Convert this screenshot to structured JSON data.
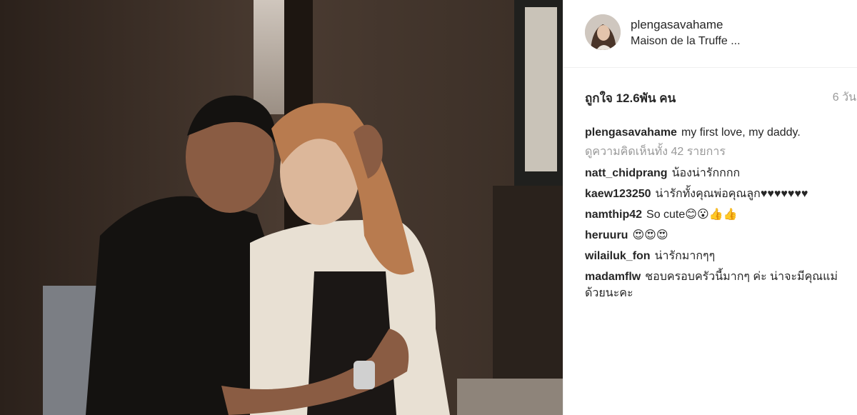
{
  "header": {
    "username": "plengasavahame",
    "location": "Maison de la Truffe ..."
  },
  "stats": {
    "likes": "ถูกใจ 12.6พัน คน",
    "time": "6 วัน"
  },
  "caption": {
    "username": "plengasavahame",
    "text": "my first love, my daddy."
  },
  "view_all": "ดูความคิดเห็นทั้ง 42 รายการ",
  "comments": [
    {
      "username": "natt_chidprang",
      "text": "น้องน่ารักกกก"
    },
    {
      "username": "kaew123250",
      "text": "น่ารักทั้งคุณพ่อคุณลูก♥♥♥♥♥♥♥"
    },
    {
      "username": "namthip42",
      "text": "So cute😊😮👍👍"
    },
    {
      "username": "heruuru",
      "text": "😍😍😍"
    },
    {
      "username": "wilailuk_fon",
      "text": "น่ารักมากๆๆ"
    },
    {
      "username": "madamflw",
      "text": "ชอบครอบครัวนี้มากๆ ค่ะ น่าจะมีคุณแม่ด้วยนะคะ"
    }
  ]
}
